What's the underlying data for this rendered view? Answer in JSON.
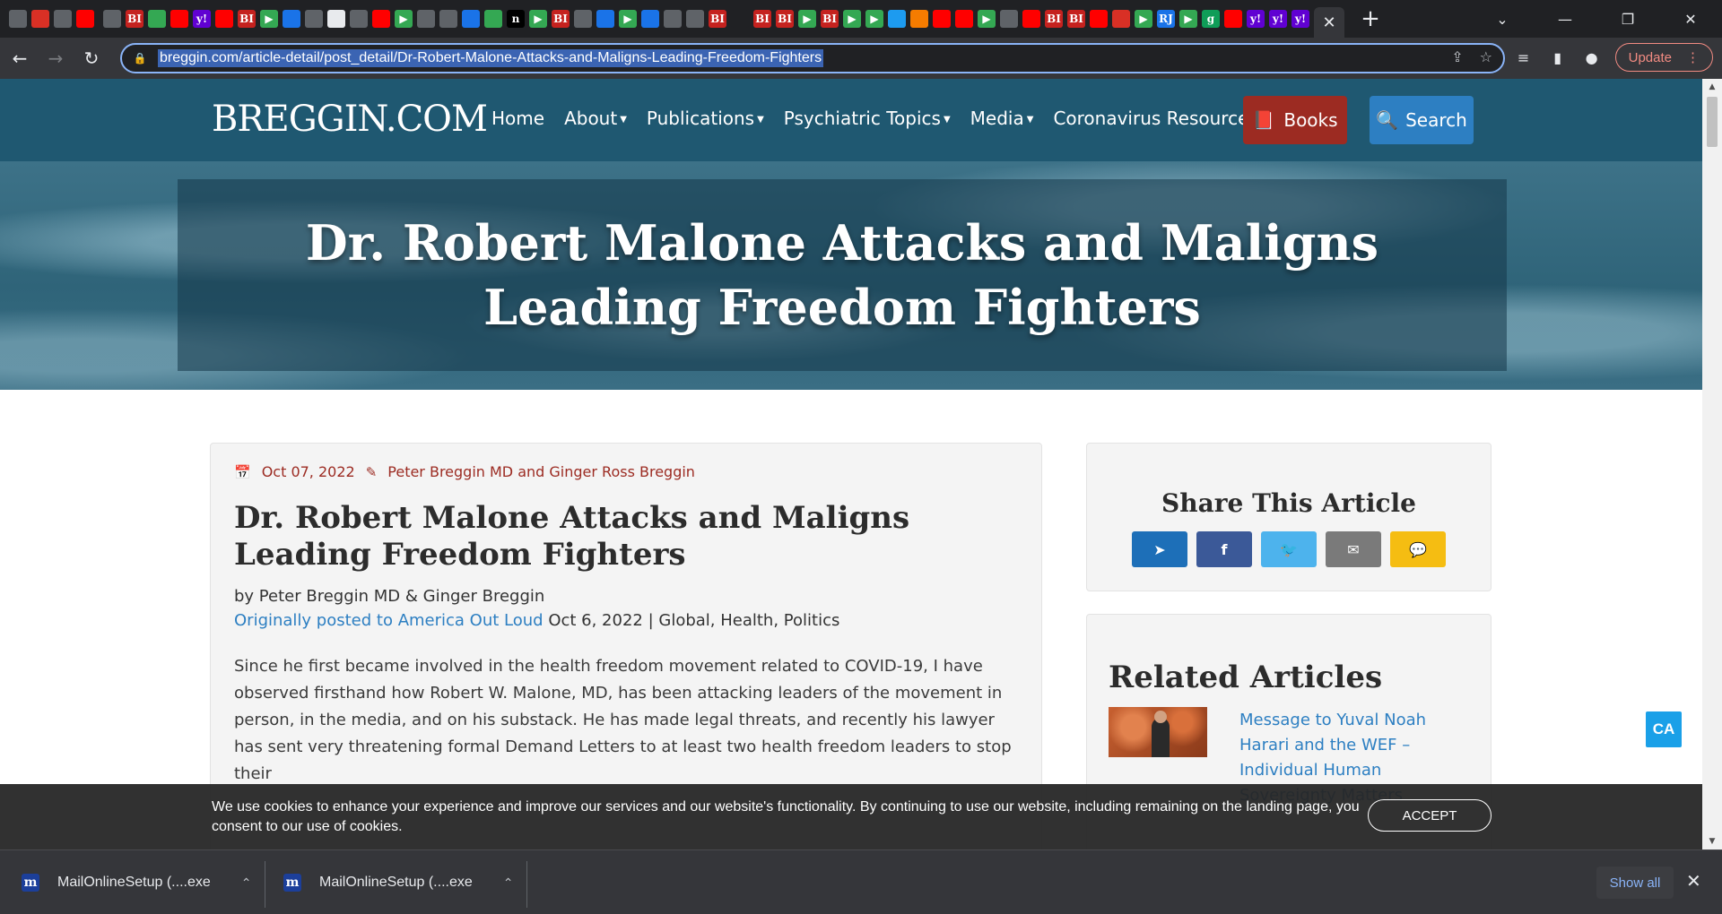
{
  "browser": {
    "tab_favicons": [
      {
        "icon": "globe-icon",
        "color": "#5f6368",
        "text": ""
      },
      {
        "icon": "app-icon",
        "color": "#d93025",
        "text": ""
      },
      {
        "icon": "globe-icon",
        "color": "#5f6368",
        "text": ""
      },
      {
        "icon": "youtube-icon",
        "color": "#ff0000",
        "text": ""
      },
      {
        "icon": "globe-icon",
        "color": "#5f6368",
        "text": ""
      },
      {
        "icon": "bi-icon",
        "color": "#c5221f",
        "text": "BI"
      },
      {
        "icon": "globe-icon",
        "color": "#34a853",
        "text": ""
      },
      {
        "icon": "youtube-icon",
        "color": "#ff0000",
        "text": ""
      },
      {
        "icon": "yahoo-icon",
        "color": "#6001d2",
        "text": "y!"
      },
      {
        "icon": "youtube-icon",
        "color": "#ff0000",
        "text": ""
      },
      {
        "icon": "bi-icon",
        "color": "#c5221f",
        "text": "BI"
      },
      {
        "icon": "play-icon",
        "color": "#34a853",
        "text": "▶"
      },
      {
        "icon": "shield-icon",
        "color": "#1a73e8",
        "text": ""
      },
      {
        "icon": "flag-icon",
        "color": "#5f6368",
        "text": ""
      },
      {
        "icon": "grid-icon",
        "color": "#e8eaed",
        "text": ""
      },
      {
        "icon": "globe-icon",
        "color": "#5f6368",
        "text": ""
      },
      {
        "icon": "youtube-icon",
        "color": "#ff0000",
        "text": ""
      },
      {
        "icon": "play-icon",
        "color": "#34a853",
        "text": "▶"
      },
      {
        "icon": "globe-icon",
        "color": "#5f6368",
        "text": ""
      },
      {
        "icon": "flag-icon",
        "color": "#5f6368",
        "text": ""
      },
      {
        "icon": "search-icon",
        "color": "#1a73e8",
        "text": ""
      },
      {
        "icon": "globe-icon",
        "color": "#34a853",
        "text": ""
      },
      {
        "icon": "n-icon",
        "color": "#000000",
        "text": "n"
      },
      {
        "icon": "play-icon",
        "color": "#34a853",
        "text": "▶"
      },
      {
        "icon": "bi-icon",
        "color": "#c5221f",
        "text": "BI"
      },
      {
        "icon": "globe-icon",
        "color": "#5f6368",
        "text": ""
      },
      {
        "icon": "shield-icon",
        "color": "#1a73e8",
        "text": ""
      },
      {
        "icon": "play-icon",
        "color": "#34a853",
        "text": "▶"
      },
      {
        "icon": "search-icon",
        "color": "#1a73e8",
        "text": ""
      },
      {
        "icon": "globe-icon",
        "color": "#5f6368",
        "text": ""
      },
      {
        "icon": "flag-icon",
        "color": "#5f6368",
        "text": ""
      },
      {
        "icon": "bi-icon",
        "color": "#c5221f",
        "text": "BI"
      },
      {
        "icon": "aol-icon",
        "color": "#202124",
        "text": ""
      },
      {
        "icon": "bi-icon",
        "color": "#c5221f",
        "text": "BI"
      },
      {
        "icon": "bi-icon",
        "color": "#c5221f",
        "text": "BI"
      },
      {
        "icon": "play-icon",
        "color": "#34a853",
        "text": "▶"
      },
      {
        "icon": "bi-icon",
        "color": "#c5221f",
        "text": "BI"
      },
      {
        "icon": "play-icon",
        "color": "#34a853",
        "text": "▶"
      },
      {
        "icon": "play-icon",
        "color": "#34a853",
        "text": "▶"
      },
      {
        "icon": "twitter-icon",
        "color": "#1d9bf0",
        "text": ""
      },
      {
        "icon": "bookmark-icon",
        "color": "#f57c00",
        "text": ""
      },
      {
        "icon": "youtube-icon",
        "color": "#ff0000",
        "text": ""
      },
      {
        "icon": "youtube-icon",
        "color": "#ff0000",
        "text": ""
      },
      {
        "icon": "play-icon",
        "color": "#34a853",
        "text": "▶"
      },
      {
        "icon": "globe-icon",
        "color": "#5f6368",
        "text": ""
      },
      {
        "icon": "youtube-icon",
        "color": "#ff0000",
        "text": ""
      },
      {
        "icon": "bi-icon",
        "color": "#c5221f",
        "text": "BI"
      },
      {
        "icon": "bi-icon",
        "color": "#c5221f",
        "text": "BI"
      },
      {
        "icon": "youtube-icon",
        "color": "#ff0000",
        "text": ""
      },
      {
        "icon": "download-icon",
        "color": "#d93025",
        "text": ""
      },
      {
        "icon": "play-icon",
        "color": "#34a853",
        "text": "▶"
      },
      {
        "icon": "rj-icon",
        "color": "#1a73e8",
        "text": "RJ"
      },
      {
        "icon": "play-icon",
        "color": "#34a853",
        "text": "▶"
      },
      {
        "icon": "g-icon",
        "color": "#0f9d58",
        "text": "g"
      },
      {
        "icon": "youtube-icon",
        "color": "#ff0000",
        "text": ""
      },
      {
        "icon": "yahoo-icon",
        "color": "#6001d2",
        "text": "y!"
      },
      {
        "icon": "yahoo-icon",
        "color": "#6001d2",
        "text": "y!"
      },
      {
        "icon": "yahoo-icon",
        "color": "#6001d2",
        "text": "y!"
      }
    ],
    "active_tab_icon": "close-icon",
    "url": "breggin.com/article-detail/post_detail/Dr-Robert-Malone-Attacks-and-Maligns-Leading-Freedom-Fighters",
    "update_label": "Update"
  },
  "site": {
    "logo": "BREGGIN.COM",
    "nav": [
      {
        "label": "Home",
        "dropdown": false
      },
      {
        "label": "About",
        "dropdown": true
      },
      {
        "label": "Publications",
        "dropdown": true
      },
      {
        "label": "Psychiatric Topics",
        "dropdown": true
      },
      {
        "label": "Media",
        "dropdown": true
      },
      {
        "label": "Coronavirus Resources",
        "dropdown": false
      }
    ],
    "books_label": "Books",
    "search_label": "Search",
    "colors": {
      "header": "#1f5871",
      "books": "#9c2b22",
      "search": "#2d7fc2",
      "link": "#2d7fc2"
    }
  },
  "hero": {
    "title": "Dr. Robert Malone Attacks and Maligns Leading Freedom Fighters"
  },
  "article": {
    "date": "Oct 07, 2022",
    "author_meta": "Peter Breggin MD and Ginger Ross Breggin",
    "title": "Dr. Robert Malone Attacks and Maligns Leading Freedom Fighters",
    "byline": "by Peter Breggin MD & Ginger Breggin",
    "posted_link": "Originally posted to America Out Loud",
    "posted_rest": " Oct 6, 2022 | Global, Health, Politics",
    "body": "Since he first became involved in the health freedom movement related to COVID-19, I have observed firsthand how Robert W. Malone, MD, has been attacking leaders of the movement in person, in the media, and on his substack. He has made legal threats, and recently his lawyer has sent very threatening formal Demand Letters to at least two health freedom leaders to stop their"
  },
  "share": {
    "title": "Share This Article",
    "buttons": [
      {
        "name": "telegram",
        "icon": "telegram-icon",
        "glyph": "➤",
        "color": "#1d6fb8"
      },
      {
        "name": "facebook",
        "icon": "facebook-icon",
        "glyph": "f",
        "color": "#3b5998"
      },
      {
        "name": "twitter",
        "icon": "twitter-icon",
        "glyph": "🐦",
        "color": "#4db3ed"
      },
      {
        "name": "email",
        "icon": "mail-icon",
        "glyph": "✉",
        "color": "#7a7a7a"
      },
      {
        "name": "sms",
        "icon": "sms-icon",
        "glyph": "💬",
        "color": "#f5bd12"
      }
    ]
  },
  "related": {
    "title": "Related Articles",
    "items": [
      {
        "title": "Message to Yuval Noah Harari and the WEF – Individual Human Sovereignty Matters"
      }
    ]
  },
  "ca_badge": "CA",
  "cookie": {
    "text": "We use cookies to enhance your experience and improve our services and our website's functionality. By continuing to use our website, including remaining on the landing page, you consent to our use of cookies.",
    "accept_label": "ACCEPT"
  },
  "downloads": {
    "items": [
      {
        "name": "MailOnlineSetup (....exe",
        "icon": "mailonline-icon"
      },
      {
        "name": "MailOnlineSetup (....exe",
        "icon": "mailonline-icon"
      }
    ],
    "show_all_label": "Show all"
  }
}
